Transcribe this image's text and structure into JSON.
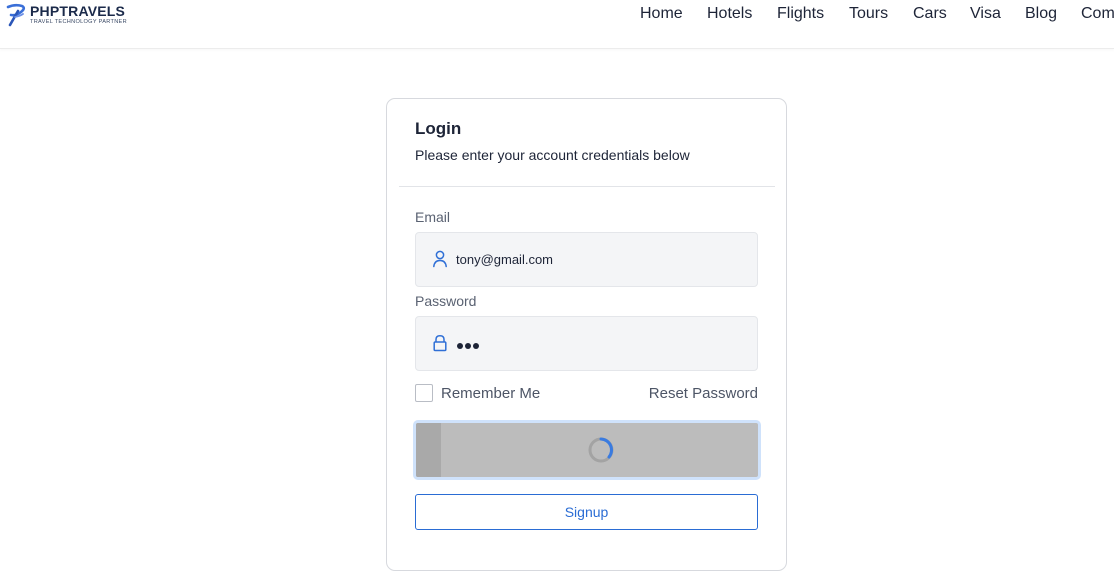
{
  "header": {
    "logo": {
      "name": "PHPTRAVELS",
      "tagline": "TRAVEL TECHNOLOGY PARTNER"
    },
    "nav": [
      "Home",
      "Hotels",
      "Flights",
      "Tours",
      "Cars",
      "Visa",
      "Blog",
      "Com"
    ]
  },
  "login": {
    "title": "Login",
    "subtitle": "Please enter your account credentials below",
    "email": {
      "label": "Email",
      "value": "tony@gmail.com",
      "icon": "user-icon"
    },
    "password": {
      "label": "Password",
      "masked_length": 3,
      "icon": "lock-icon"
    },
    "remember_me": {
      "label": "Remember Me",
      "checked": false
    },
    "reset_password": "Reset Password",
    "login_button": {
      "state": "loading"
    },
    "signup_button": "Signup"
  },
  "colors": {
    "accent": "#2a6cd4",
    "brand": "#1b2a4a",
    "loading_button": "#bcbcbc",
    "spinner": "#3a7be0"
  }
}
